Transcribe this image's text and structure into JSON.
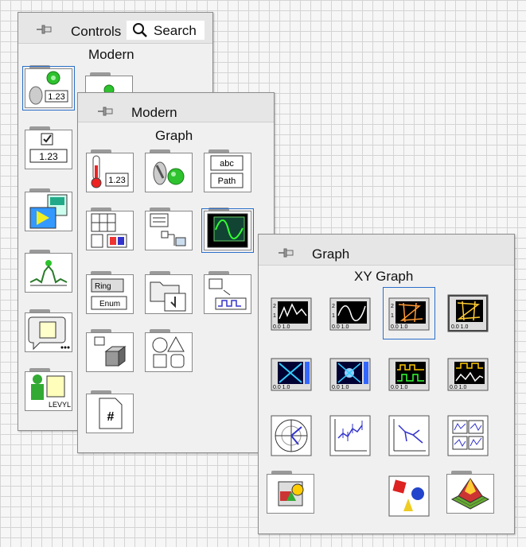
{
  "controls_palette": {
    "title": "Controls",
    "search_label": "Search",
    "subtitle": "Modern"
  },
  "modern_palette": {
    "title": "Modern",
    "subtitle": "Graph",
    "icons": [
      {
        "name": "numeric",
        "label": "1.23"
      },
      {
        "name": "boolean"
      },
      {
        "name": "string-path",
        "label1": "abc",
        "label2": "Path"
      },
      {
        "name": "array-matrix-cluster"
      },
      {
        "name": "list-table-tree"
      },
      {
        "name": "graph",
        "selected": true
      },
      {
        "name": "ring-enum",
        "label1": "Ring",
        "label2": "Enum"
      },
      {
        "name": "containers"
      },
      {
        "name": "io"
      },
      {
        "name": "variant-class"
      },
      {
        "name": "decorations"
      },
      {
        "name": "refnum",
        "label": "#"
      }
    ]
  },
  "graph_palette": {
    "title": "Graph",
    "subtitle": "XY Graph",
    "icons": [
      {
        "name": "waveform-chart"
      },
      {
        "name": "waveform-graph"
      },
      {
        "name": "xy-graph",
        "selected": true
      },
      {
        "name": "ex-xy-graph"
      },
      {
        "name": "intensity-chart"
      },
      {
        "name": "intensity-graph"
      },
      {
        "name": "digital-waveform-graph"
      },
      {
        "name": "mixed-signal-graph"
      },
      {
        "name": "compass-plot"
      },
      {
        "name": "error-bar-plot"
      },
      {
        "name": "feather-plot"
      },
      {
        "name": "xy-plot-matrix"
      },
      {
        "name": "controls-3d"
      },
      {
        "name": "picture"
      },
      {
        "name": "3d-surface"
      }
    ]
  },
  "controls_column_labels": {
    "numeric": "1.23",
    "boolean_numeric": "1.23",
    "vendor": "LEVYLAB"
  }
}
